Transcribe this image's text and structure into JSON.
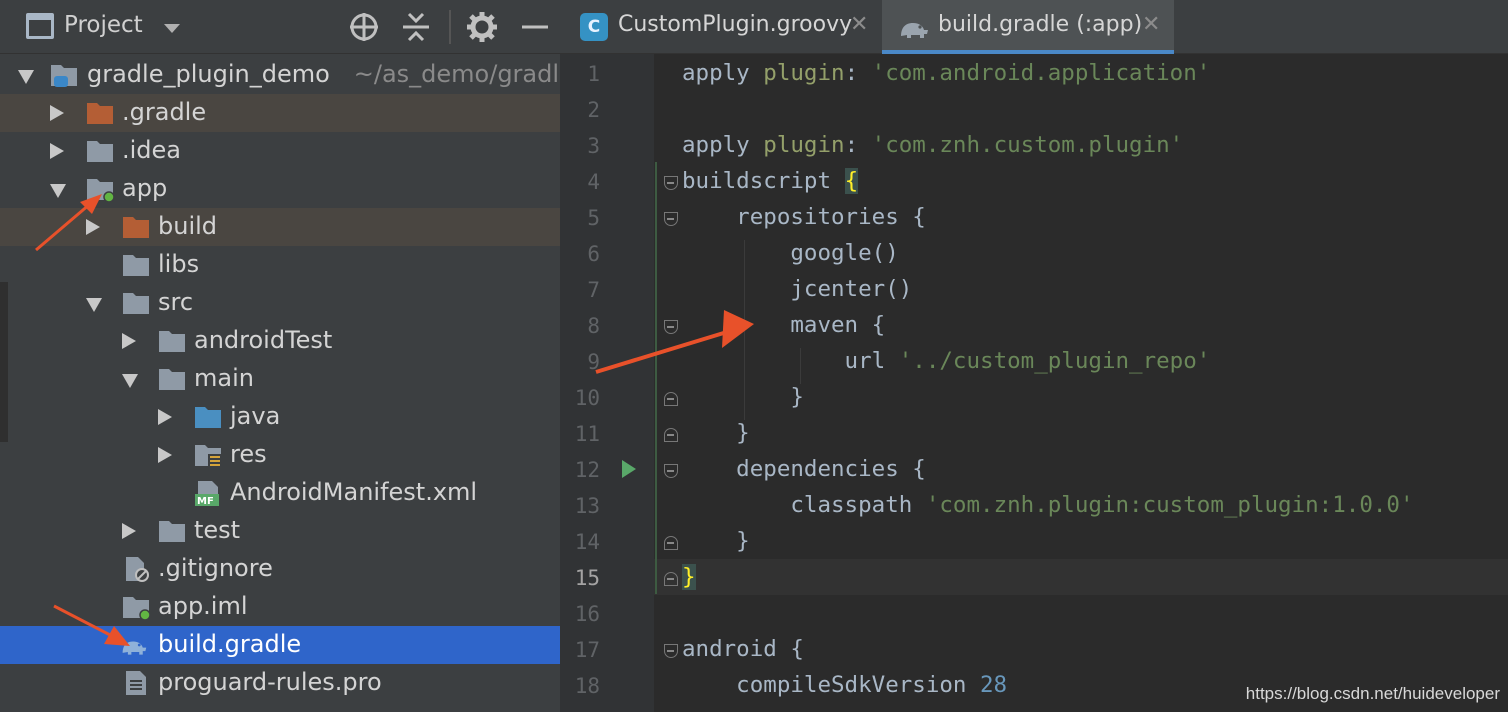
{
  "project_panel": {
    "title": "Project",
    "tree": [
      {
        "label": "gradle_plugin_demo",
        "suffix": "~/as_demo/gradle"
      },
      {
        "label": ".gradle"
      },
      {
        "label": ".idea"
      },
      {
        "label": "app"
      },
      {
        "label": "build"
      },
      {
        "label": "libs"
      },
      {
        "label": "src"
      },
      {
        "label": "androidTest"
      },
      {
        "label": "main"
      },
      {
        "label": "java"
      },
      {
        "label": "res"
      },
      {
        "label": "AndroidManifest.xml"
      },
      {
        "label": "test"
      },
      {
        "label": ".gitignore"
      },
      {
        "label": "app.iml"
      },
      {
        "label": "build.gradle"
      },
      {
        "label": "proguard-rules.pro"
      }
    ]
  },
  "tabs": [
    {
      "label": "CustomPlugin.groovy",
      "icon_letter": "C"
    },
    {
      "label": "build.gradle (:app)"
    }
  ],
  "editor": {
    "line_numbers": [
      "1",
      "2",
      "3",
      "4",
      "5",
      "6",
      "7",
      "8",
      "9",
      "10",
      "11",
      "12",
      "13",
      "14",
      "15",
      "16",
      "17",
      "18"
    ],
    "code": {
      "l1_a": "apply ",
      "l1_b": "plugin",
      "l1_c": ": ",
      "l1_d": "'com.android.application'",
      "l3_a": "apply ",
      "l3_b": "plugin",
      "l3_c": ": ",
      "l3_d": "'com.znh.custom.plugin'",
      "l4_a": "buildscript ",
      "l4_b": "{",
      "l5": "    repositories {",
      "l6": "        google()",
      "l7": "        jcenter()",
      "l8": "        maven {",
      "l9_a": "            url ",
      "l9_b": "'../custom_plugin_repo'",
      "l10": "        }",
      "l11": "    }",
      "l12": "    dependencies {",
      "l13_a": "        classpath ",
      "l13_b": "'com.znh.plugin:custom_plugin:1.0.0'",
      "l14": "    }",
      "l15": "}",
      "l17": "android {",
      "l18_a": "    compileSdkVersion ",
      "l18_b": "28"
    }
  },
  "watermark": "https://blog.csdn.net/huideveloper",
  "colors": {
    "panel_bg": "#3c3f41",
    "editor_bg": "#2b2b2b",
    "selection": "#2f65ca",
    "string": "#6a8759",
    "number": "#6897bb",
    "annotation_arrow": "#e8512a"
  }
}
